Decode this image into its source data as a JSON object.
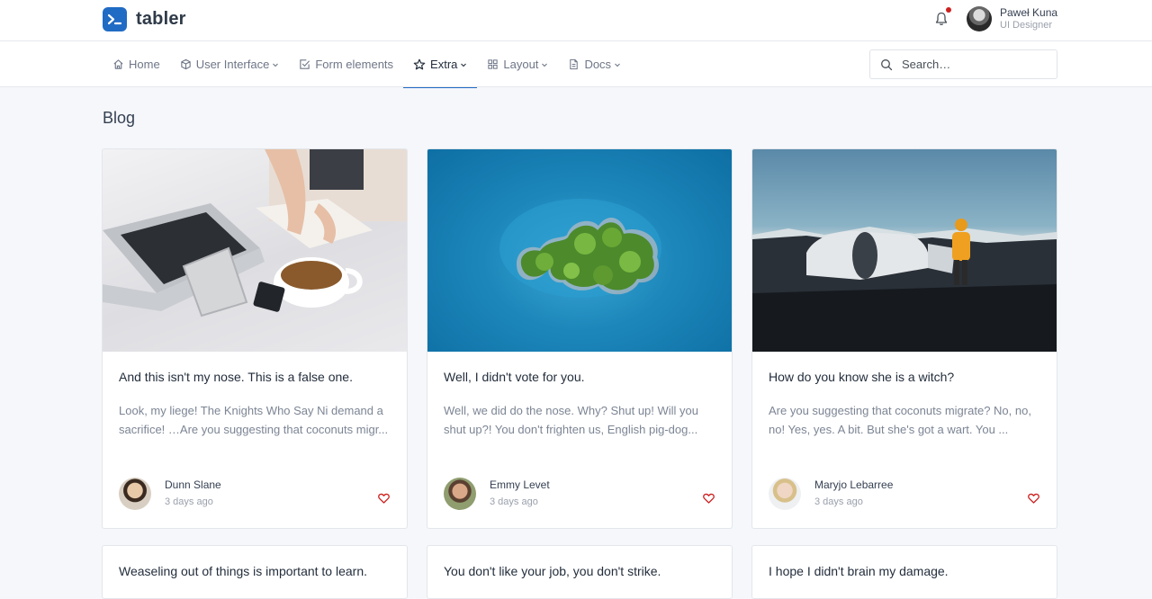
{
  "brand": {
    "name": "tabler"
  },
  "user": {
    "name": "Paweł Kuna",
    "role": "UI Designer"
  },
  "nav": [
    {
      "label": "Home",
      "icon": "home-icon"
    },
    {
      "label": "User Interface",
      "icon": "box-icon"
    },
    {
      "label": "Form elements",
      "icon": "check-square-icon"
    },
    {
      "label": "Extra",
      "icon": "star-icon",
      "active": true
    },
    {
      "label": "Layout",
      "icon": "grid-icon"
    },
    {
      "label": "Docs",
      "icon": "file-icon"
    }
  ],
  "search": {
    "placeholder": "Search…"
  },
  "page": {
    "title": "Blog"
  },
  "posts": [
    {
      "title": "And this isn't my nose. This is a false one.",
      "excerpt": "Look, my liege! The Knights Who Say Ni demand a sacrifice! …Are you suggesting that coconuts migr...",
      "author": "Dunn Slane",
      "time": "3 days ago"
    },
    {
      "title": "Well, I didn't vote for you.",
      "excerpt": "Well, we did do the nose. Why? Shut up! Will you shut up?! You don't frighten us, English pig-dog...",
      "author": "Emmy Levet",
      "time": "3 days ago"
    },
    {
      "title": "How do you know she is a witch?",
      "excerpt": "Are you suggesting that coconuts migrate? No, no, no! Yes, yes. A bit. But she's got a wart. You ...",
      "author": "Maryjo Lebarree",
      "time": "3 days ago"
    },
    {
      "title": "Weaseling out of things is important to learn."
    },
    {
      "title": "You don't like your job, you don't strike."
    },
    {
      "title": "I hope I didn't brain my damage."
    }
  ],
  "colors": {
    "accent": "#206bc4",
    "like": "#cd201f",
    "notification": "#cd201f"
  }
}
